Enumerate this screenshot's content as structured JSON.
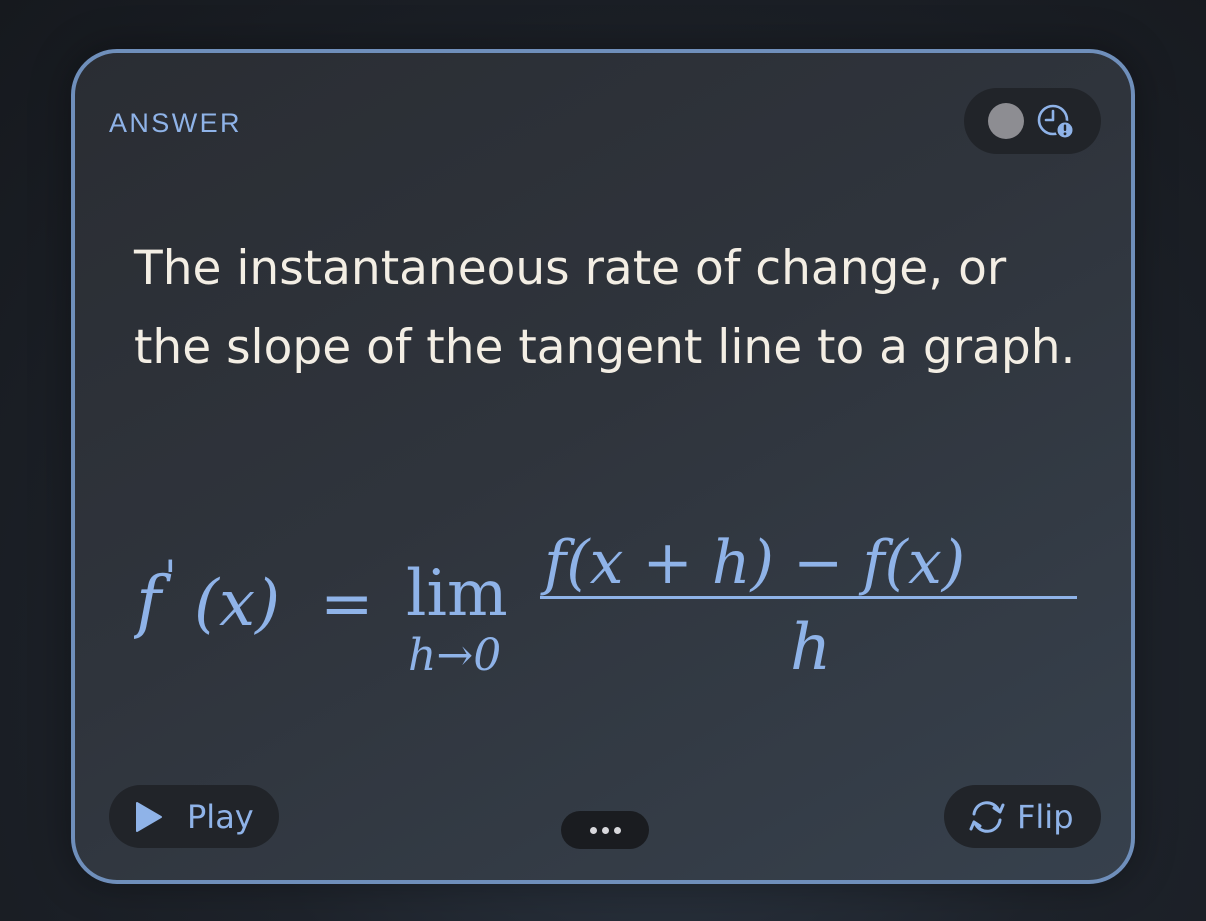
{
  "card": {
    "label": "ANSWER",
    "answer_text": "The instantaneous rate of change, or the slope of the tangent line to a graph.",
    "formula": {
      "lhs_f": "f",
      "lhs_prime": "'",
      "lhs_arg": "(x)",
      "equals": "=",
      "lim": "lim",
      "lim_sub": "h→0",
      "numerator": "f(x + h) − f(x)",
      "denominator": "h"
    }
  },
  "status": {
    "dot_color": "#8d8d92",
    "icon": "clock-alert-icon"
  },
  "controls": {
    "play_label": "Play",
    "play_icon": "play-icon",
    "flip_label": "Flip",
    "flip_icon": "refresh-icon",
    "more_icon": "ellipsis-icon"
  },
  "colors": {
    "accent": "#8fb3e8",
    "border": "#6f8fbb",
    "text": "#f3eee4"
  }
}
